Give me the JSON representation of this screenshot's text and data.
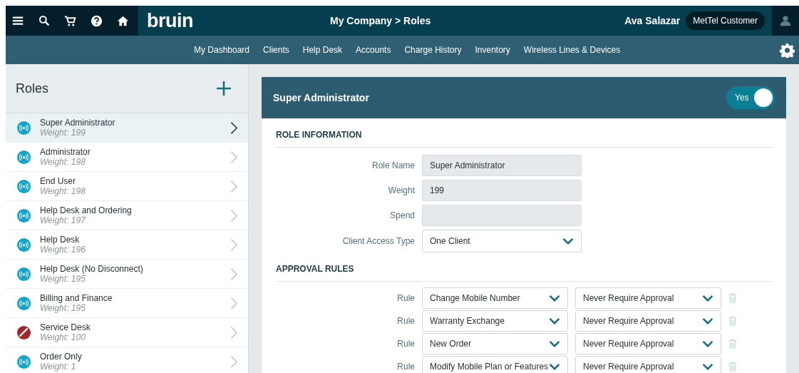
{
  "top_bar": {
    "logo": "bruin",
    "breadcrumb": "My Company > Roles",
    "user_name": "Ava Salazar",
    "account_badge": "MetTel Customer"
  },
  "nav": {
    "items": [
      "My Dashboard",
      "Clients",
      "Help Desk",
      "Accounts",
      "Charge History",
      "Inventory",
      "Wireless Lines & Devices"
    ]
  },
  "sidebar": {
    "title": "Roles",
    "items": [
      {
        "name": "Super Administrator",
        "weight": "Weight: 199",
        "kind": "active",
        "selected": true
      },
      {
        "name": "Administrator",
        "weight": "Weight: 198",
        "kind": "active",
        "selected": false
      },
      {
        "name": "End User",
        "weight": "Weight: 198",
        "kind": "active",
        "selected": false
      },
      {
        "name": "Help Desk and Ordering",
        "weight": "Weight: 197",
        "kind": "active",
        "selected": false
      },
      {
        "name": "Help Desk",
        "weight": "Weight: 196",
        "kind": "active",
        "selected": false
      },
      {
        "name": "Help Desk (No Disconnect)",
        "weight": "Weight: 195",
        "kind": "active",
        "selected": false
      },
      {
        "name": "Billing and Finance",
        "weight": "Weight: 195",
        "kind": "active",
        "selected": false
      },
      {
        "name": "Service Desk",
        "weight": "Weight: 100",
        "kind": "blocked",
        "selected": false
      },
      {
        "name": "Order Only",
        "weight": "Weight: 1",
        "kind": "active",
        "selected": false
      }
    ]
  },
  "detail": {
    "title": "Super Administrator",
    "toggle": {
      "label": "Yes",
      "on": true
    },
    "role_information": {
      "heading": "ROLE INFORMATION",
      "fields": [
        {
          "label": "Role Name",
          "value": "Super Administrator",
          "kind": "text"
        },
        {
          "label": "Weight",
          "value": "199",
          "kind": "text"
        },
        {
          "label": "Spend",
          "kind": "text"
        },
        {
          "label": "Client Access Type",
          "value": "One Client",
          "kind": "select"
        }
      ]
    },
    "approval_rules": {
      "heading": "APPROVAL RULES",
      "rules": [
        {
          "label": "Rule",
          "action": "Change Mobile Number",
          "approval": "Never Require Approval"
        },
        {
          "label": "Rule",
          "action": "Warranty Exchange",
          "approval": "Never Require Approval"
        },
        {
          "label": "Rule",
          "action": "New Order",
          "approval": "Never Require Approval"
        },
        {
          "label": "Rule",
          "action": "Modify Mobile Plan or Features",
          "approval": "Never Require Approval"
        }
      ]
    }
  }
}
